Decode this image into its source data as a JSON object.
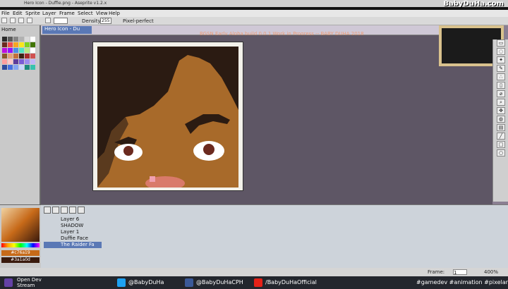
{
  "window": {
    "title": "Hero Icon - Duffie.png - Aseprite v1.2.x",
    "overlay_brand": "BabyDuHa.com"
  },
  "menu": [
    "File",
    "Edit",
    "Sprite",
    "Layer",
    "Frame",
    "Select",
    "View",
    "Help"
  ],
  "toolbar": {
    "home_tab": "Home",
    "doc_tab": "Hero Icon - Du",
    "density_label": "Density:",
    "density_value": "255",
    "pixel_perfect": "Pixel-perfect"
  },
  "banner": "BGSN Early Alpha build 0.0.1 Work in Progress -- BABY DUHA 2018",
  "palette": {
    "colors": [
      "#2b2b2b",
      "#5a5a5a",
      "#858585",
      "#b1b1b1",
      "#d9d9d9",
      "#ffffff",
      "#6b2a1f",
      "#f04e4e",
      "#f6a623",
      "#f8e71c",
      "#7ed321",
      "#417505",
      "#bd10e0",
      "#9013fe",
      "#4a90e2",
      "#50e3c2",
      "#b8e986",
      "#ffffff",
      "#8b572a",
      "#e2a17a",
      "#c2703a",
      "#3d2315",
      "#a62b2b",
      "#d05151",
      "#ff9e9e",
      "#ffc8c8",
      "#5e3c9b",
      "#7b5cd6",
      "#9d8bef",
      "#c1b5f7",
      "#2f4a9c",
      "#4670e0",
      "#86a6f2",
      "#c7d6fb",
      "#1d8a7d",
      "#37c2ae"
    ]
  },
  "color_picker": {
    "hex_primary": "#c76a19",
    "hex_secondary": "#3a1a0d"
  },
  "layers": [
    {
      "name": "Layer 6"
    },
    {
      "name": "SHADOW"
    },
    {
      "name": "Layer 1"
    },
    {
      "name": "Duffie Face"
    },
    {
      "name": "The Raider Fa"
    }
  ],
  "status": {
    "frame": "Frame:",
    "frame_value": "1",
    "zoom": "400%"
  },
  "stream": {
    "label1": "Open Dev",
    "label2": "Stream",
    "handle_twitter": "@BabyDuHa",
    "handle_fb": "@BabyDuHaCPH",
    "handle_youtube": "/BabyDuHaOfficial",
    "hashtags": "#gamedev #animation #pixelart"
  },
  "colors": {
    "accent": "#5a78b5",
    "canvas_bg": "#8a7f92",
    "hair": "#2b1b12",
    "skin": "#a86a2a",
    "lip": "#d97a6a"
  }
}
